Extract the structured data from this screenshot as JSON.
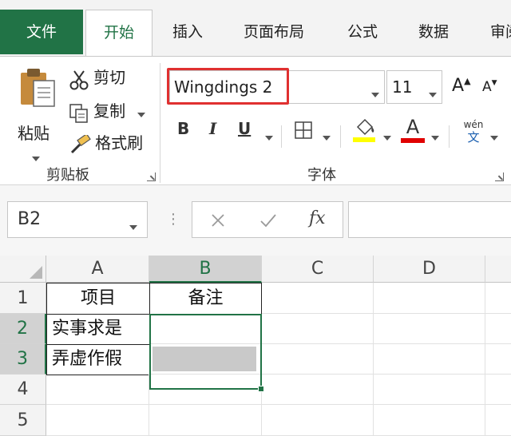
{
  "tabs": [
    "文件",
    "开始",
    "插入",
    "页面布局",
    "公式",
    "数据",
    "审阅"
  ],
  "clipboard": {
    "paste_label": "粘贴",
    "cut_label": "剪切",
    "copy_label": "复制",
    "format_painter_label": "格式刷",
    "group_label": "剪贴板"
  },
  "font": {
    "font_name": "Wingdings 2",
    "font_size": "11",
    "bold_label": "B",
    "italic_label": "I",
    "underline_label": "U",
    "phonetic_top": "wén",
    "phonetic_bottom": "文",
    "font_color_label": "A",
    "grow_label": "A",
    "shrink_label": "A",
    "group_label": "字体",
    "fill_color": "#ffff00",
    "font_color": "#e00000"
  },
  "formula_bar": {
    "name_box": "B2",
    "fx_label": "fx",
    "formula": ""
  },
  "grid": {
    "columns": [
      "A",
      "B",
      "C",
      "D"
    ],
    "rows": [
      "1",
      "2",
      "3",
      "4",
      "5"
    ],
    "cells": {
      "A1": "项目",
      "B1": "备注",
      "A2": "实事求是",
      "A3": "弄虚作假",
      "B2": "",
      "B3": ""
    },
    "accent": "#217346"
  }
}
